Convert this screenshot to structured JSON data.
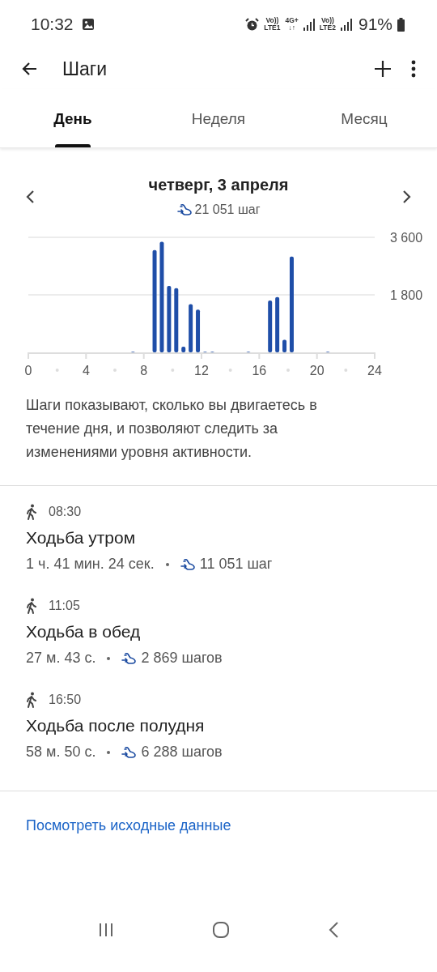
{
  "status_bar": {
    "time": "10:32",
    "network_1": {
      "top": "Vo))",
      "bottom": "LTE1"
    },
    "data": {
      "top": "4G+",
      "bottom": "↓↑"
    },
    "network_2": {
      "top": "Vo))",
      "bottom": "LTE2"
    },
    "battery": "91%"
  },
  "app_bar": {
    "title": "Шаги"
  },
  "tabs": [
    {
      "label": "День",
      "selected": true
    },
    {
      "label": "Неделя",
      "selected": false
    },
    {
      "label": "Месяц",
      "selected": false
    }
  ],
  "day": {
    "date": "четверг, 3 апреля",
    "total": "21 051 шаг"
  },
  "chart_data": {
    "type": "bar",
    "x": [
      7.25,
      8.75,
      9.25,
      9.75,
      10.25,
      10.75,
      11.25,
      11.75,
      12.25,
      12.75,
      15.25,
      16.75,
      17.25,
      17.75,
      18.25,
      20.75
    ],
    "values": [
      20,
      3200,
      3460,
      2080,
      2010,
      180,
      1510,
      1340,
      20,
      20,
      20,
      1620,
      1730,
      390,
      3000,
      20
    ],
    "xlim": [
      0,
      24
    ],
    "ylim": [
      0,
      3600
    ],
    "xticks": [
      0,
      4,
      8,
      12,
      16,
      20,
      24
    ],
    "yticks": [
      {
        "value": 1800,
        "label": "1 800"
      },
      {
        "value": 3600,
        "label": "3 600"
      }
    ]
  },
  "description": "Шаги показывают, сколько вы двигаетесь в течение дня, и позволяют следить за изменениями уровня активности.",
  "activities": [
    {
      "time": "08:30",
      "title": "Ходьба утром",
      "duration": "1 ч. 41 мин. 24 сек.",
      "steps": "11 051 шаг"
    },
    {
      "time": "11:05",
      "title": "Ходьба в обед",
      "duration": "27 м. 43 с.",
      "steps": "2 869 шагов"
    },
    {
      "time": "16:50",
      "title": "Ходьба после полудня",
      "duration": "58 м. 50 с.",
      "steps": "6 288 шагов"
    }
  ],
  "link": "Посмотреть исходные данные"
}
